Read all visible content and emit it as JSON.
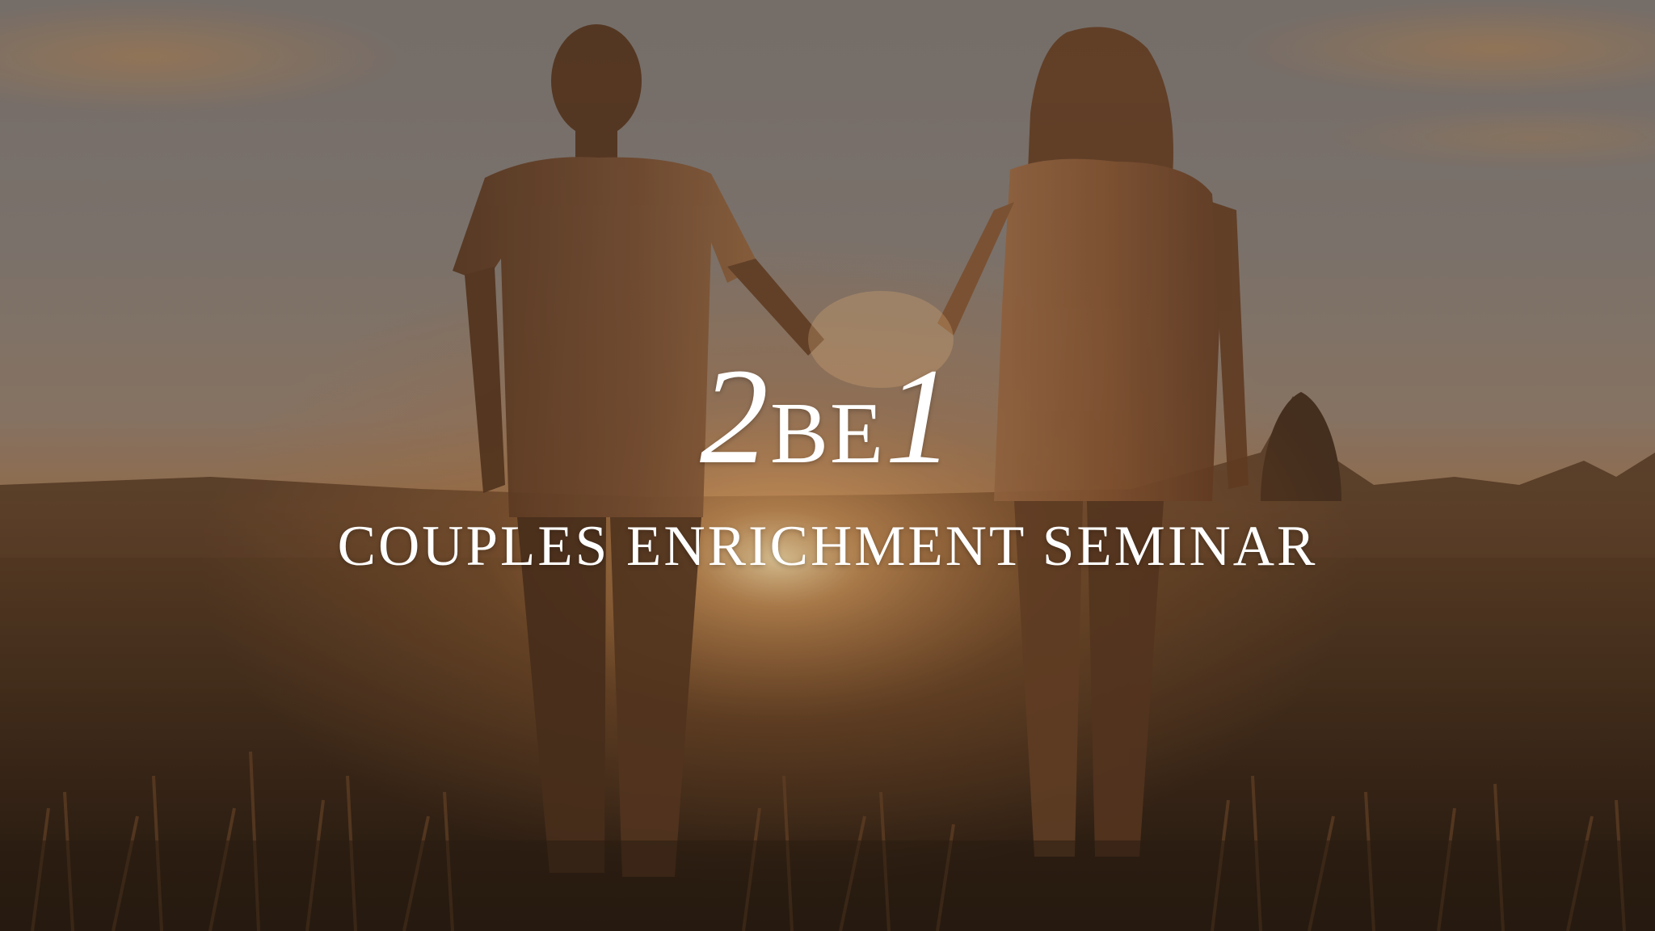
{
  "title": {
    "numeral_prefix": "2",
    "caps_middle": "BE",
    "numeral_suffix": "1"
  },
  "subtitle": "COUPLES ENRICHMENT SEMINAR",
  "colors": {
    "text": "#ffffff",
    "sky_top": "#8a847f",
    "sky_glow": "#d9a46a",
    "field": "#3a2a1c",
    "silhouette": "#7a4a2a"
  }
}
